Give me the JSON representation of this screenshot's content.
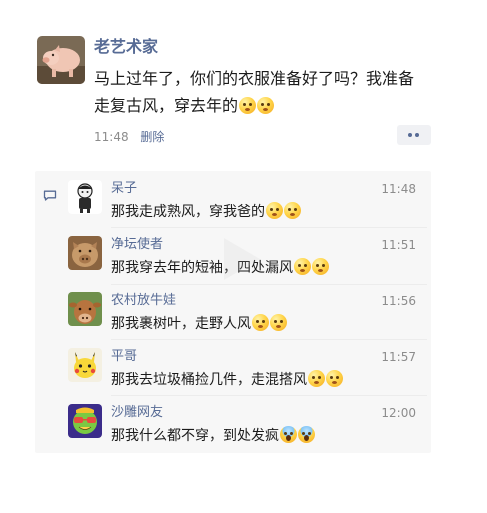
{
  "post": {
    "author": "老艺术家",
    "avatar_icon": "pig-avatar-icon",
    "text": "马上过年了，你们的衣服准备好了吗？我准备走复古风，穿去年的",
    "emojis": [
      "grimace-emoji",
      "grimace-emoji"
    ],
    "time": "11:48",
    "delete_label": "删除",
    "more_icon": "more-dots-icon"
  },
  "colors": {
    "link_blue": "#576b95",
    "meta_gray": "#8c8c8c",
    "panel_bg": "#f7f7f7"
  },
  "comment_icon": "comment-bubble-icon",
  "comments": [
    {
      "name": "呆子",
      "time": "11:48",
      "text": "那我走成熟风，穿我爸的",
      "avatar_icon": "cartoon-figure-avatar-icon",
      "emojis": [
        "grimace-emoji",
        "grimace-emoji"
      ]
    },
    {
      "name": "净坛使者",
      "time": "11:51",
      "text": "那我穿去年的短袖，四处漏风",
      "avatar_icon": "pig-face-avatar-icon",
      "emojis": [
        "grimace-emoji",
        "grimace-emoji"
      ]
    },
    {
      "name": "农村放牛娃",
      "time": "11:56",
      "text": "那我裹树叶，走野人风",
      "avatar_icon": "cow-avatar-icon",
      "emojis": [
        "grimace-emoji",
        "grimace-emoji"
      ]
    },
    {
      "name": "平哥",
      "time": "11:57",
      "text": "那我去垃圾桶捡几件，走混搭风",
      "avatar_icon": "pikachu-avatar-icon",
      "emojis": [
        "grimace-emoji",
        "grimace-emoji"
      ]
    },
    {
      "name": "沙雕网友",
      "time": "12:00",
      "text": "那我什么都不穿，到处发疯",
      "avatar_icon": "cool-emoji-avatar-icon",
      "emojis": [
        "scream-emoji",
        "scream-emoji"
      ]
    }
  ]
}
